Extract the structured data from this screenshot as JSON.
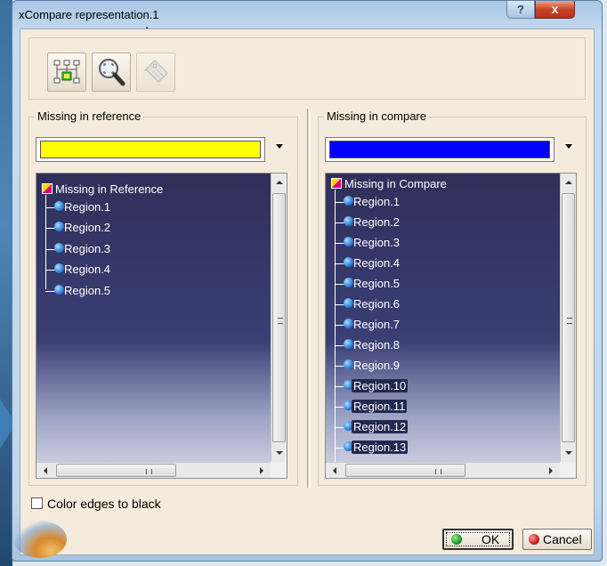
{
  "window": {
    "title": "xCompare representation.1",
    "help_label": "?",
    "close_label": "x"
  },
  "toolbar": {
    "tools": [
      "tree-structure-icon",
      "zoom-fit-icon",
      "tag-icon"
    ]
  },
  "left_panel": {
    "label": "Missing in reference",
    "color": "#ffff00",
    "tree_title": "Missing in Reference",
    "items": [
      "Region.1",
      "Region.2",
      "Region.3",
      "Region.4",
      "Region.5"
    ]
  },
  "right_panel": {
    "label": "Missing in compare",
    "color": "#0000ff",
    "tree_title": "Missing in Compare",
    "items": [
      "Region.1",
      "Region.2",
      "Region.3",
      "Region.4",
      "Region.5",
      "Region.6",
      "Region.7",
      "Region.8",
      "Region.9",
      "Region.10",
      "Region.11",
      "Region.12",
      "Region.13"
    ],
    "selected_from": 9
  },
  "scrollbar": {
    "grip_label": "III"
  },
  "options": {
    "color_edges_label": "Color edges to black",
    "color_edges_checked": false
  },
  "buttons": {
    "ok_label": "OK",
    "cancel_label": "Cancel"
  },
  "colors": {
    "ok_dot": "#1e9a2a",
    "cancel_dot": "#d02020"
  }
}
